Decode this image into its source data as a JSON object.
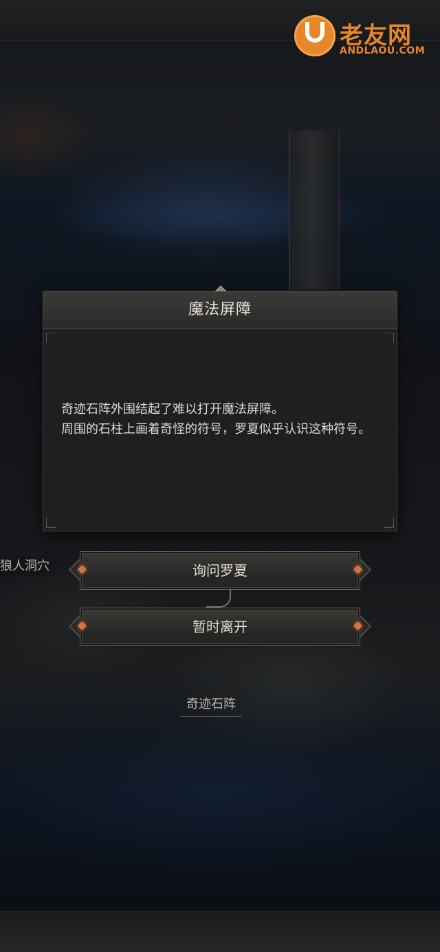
{
  "watermark": {
    "title": "老友网",
    "url": "ANDLAOU.COM"
  },
  "dialog": {
    "title": "魔法屏障",
    "body_lines": [
      "奇迹石阵外围结起了难以打开魔法屏障。",
      "周围的石柱上画着奇怪的符号，罗夏似乎认识这种符号。"
    ]
  },
  "choices": [
    {
      "label": "询问罗夏"
    },
    {
      "label": "暂时离开"
    }
  ],
  "map_labels": {
    "cave": "狼人洞穴",
    "stones": "奇迹石阵"
  },
  "colors": {
    "accent_gem": "#d5743e",
    "watermark_orange": "#e8862a",
    "dialog_bg": "#1f1f21"
  }
}
